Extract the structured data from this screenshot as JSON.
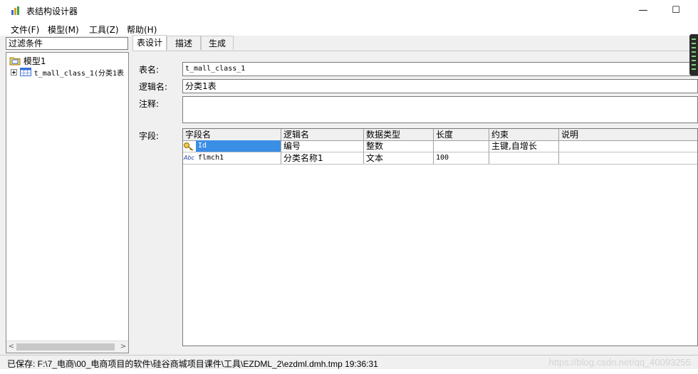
{
  "window": {
    "title": "表结构设计器",
    "minimize_glyph": "—",
    "maximize_glyph": "☐"
  },
  "menu": [
    "文件(F)",
    "模型(M)",
    "工具(Z)",
    "帮助(H)"
  ],
  "left": {
    "filter_label": "过滤条件",
    "tree": {
      "root": "模型1",
      "child": "t_mall_class_1(分类1表"
    },
    "scroll_left": "<",
    "scroll_right": ">"
  },
  "tabs": [
    "表设计",
    "描述",
    "生成"
  ],
  "form": {
    "table_name_label": "表名:",
    "table_name_value": "t_mall_class_1",
    "logical_name_label": "逻辑名:",
    "logical_name_value": "分类1表",
    "comment_label": "注释:",
    "comment_value": "",
    "fields_label": "字段:"
  },
  "grid": {
    "headers": [
      "字段名",
      "逻辑名",
      "数据类型",
      "长度",
      "约束",
      "说明"
    ],
    "rows": [
      {
        "icon": "key-icon",
        "name": "Id",
        "logical": "编号",
        "type": "整数",
        "length": "",
        "constraint": "主键,自增长",
        "desc": ""
      },
      {
        "icon": "text-type-icon",
        "icon_text": "Abc",
        "name": "flmch1",
        "logical": "分类名称1",
        "type": "文本",
        "length": "100",
        "constraint": "",
        "desc": ""
      }
    ]
  },
  "status": {
    "text": "已保存: F:\\7_电商\\00_电商项目的软件\\硅谷商城项目课件\\工具\\EZDML_2\\ezdml.dmh.tmp 19:36:31",
    "watermark": "https://blog.csdn.net/qq_40093255"
  },
  "colors": {
    "selection": "#3a8ee6",
    "window_bg": "#f0f0f0"
  }
}
